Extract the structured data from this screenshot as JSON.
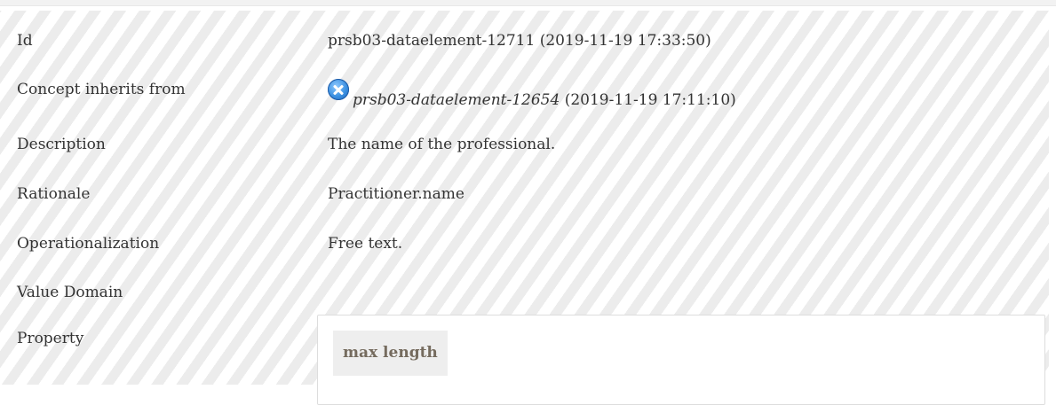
{
  "rows": [
    {
      "label": "Id",
      "value": "prsb03-dataelement-12711 (2019-11-19 17:33:50)"
    },
    {
      "label": "Concept inherits from",
      "ref": "prsb03-dataelement-12654",
      "ref_date": " (2019-11-19 17:11:10)"
    },
    {
      "label": "Description",
      "value": "The name of the professional."
    },
    {
      "label": "Rationale",
      "value": "Practitioner.name"
    },
    {
      "label": "Operationalization",
      "value": "Free text."
    },
    {
      "label": "Value Domain",
      "value": ""
    },
    {
      "label": "Property"
    }
  ],
  "property": {
    "header": "max length"
  },
  "icons": {
    "inherit": "blue-circle-x-icon"
  },
  "colors": {
    "hatch": "#ececec",
    "text": "#333333",
    "chip_text": "#756b5e",
    "chip_bg": "#eeeeee",
    "icon_blue": "#3a8fe0"
  }
}
